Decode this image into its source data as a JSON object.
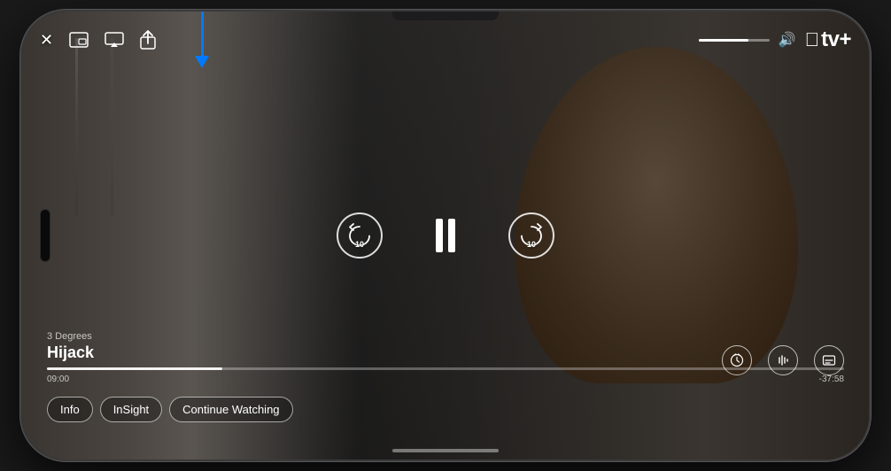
{
  "phone": {
    "frame_color": "#1c1c1e"
  },
  "header": {
    "close_icon": "✕",
    "picture_in_picture_icon": "⊡",
    "airplay_icon": "▱",
    "share_icon": "⬆",
    "volume_percent": 70,
    "apple_logo": "",
    "tv_plus_label": "tv+"
  },
  "arrow": {
    "color": "#007AFF"
  },
  "content": {
    "show_name": "3 Degrees",
    "episode_name": "Hijack"
  },
  "playback": {
    "rewind_seconds": "10",
    "forward_seconds": "10",
    "current_time": "09:00",
    "remaining_time": "-37:58",
    "progress_percent": 22
  },
  "bottom_controls": {
    "speed_icon": "⏱",
    "audio_icon": "🎙",
    "subtitles_icon": "💬"
  },
  "pills": {
    "info_label": "Info",
    "insight_label": "InSight",
    "continue_label": "Continue Watching"
  }
}
